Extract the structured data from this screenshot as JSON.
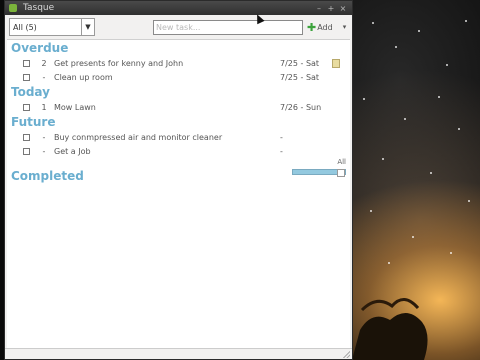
{
  "window": {
    "title": "Tasque",
    "controls": {
      "minimize": "–",
      "maximize": "+",
      "close": "×"
    }
  },
  "toolbar": {
    "category_value": "All (5)",
    "new_task_placeholder": "New task...",
    "add_label": "Add",
    "add_menu_glyph": "▾"
  },
  "sections": {
    "overdue": "Overdue",
    "today": "Today",
    "future": "Future",
    "completed": "Completed"
  },
  "tasks": {
    "overdue": [
      {
        "priority": "2",
        "name": "Get presents for kenny and John",
        "due": "7/25 - Sat",
        "has_note": true
      },
      {
        "priority": "-",
        "name": "Clean up room",
        "due": "7/25 - Sat",
        "has_note": false
      }
    ],
    "today": [
      {
        "priority": "1",
        "name": "Mow Lawn",
        "due": "7/26 - Sun",
        "has_note": false
      }
    ],
    "future": [
      {
        "priority": "-",
        "name": "Buy conmpressed air and monitor cleaner",
        "due": "-",
        "has_note": false
      },
      {
        "priority": "-",
        "name": "Get a Job",
        "due": "-",
        "has_note": false
      }
    ]
  },
  "completed": {
    "range_label": "All",
    "range_fraction": 1.0
  },
  "colors": {
    "section_header": "#6aaecf",
    "slider": "#93c9df",
    "titlebar": "#3a3a3a"
  }
}
